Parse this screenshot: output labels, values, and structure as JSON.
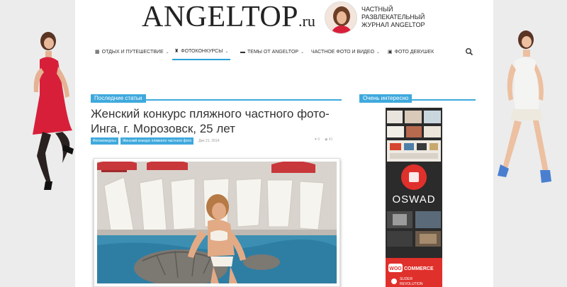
{
  "header": {
    "logo_main": "ANGELTOP",
    "logo_suffix": ".ru",
    "tagline": [
      "ЧАСТНЫЙ",
      "РАЗВЛЕКАТЕЛЬНЫЙ",
      "ЖУРНАЛ ANGELTOP"
    ]
  },
  "nav": {
    "items": [
      {
        "label": "ОТДЫХ И ПУТЕШЕСТВИЕ",
        "icon": "map-icon",
        "has_caret": true,
        "active": false
      },
      {
        "label": "ФОТОКОНКУРСЫ",
        "icon": "trophy-icon",
        "has_caret": true,
        "active": true
      },
      {
        "label": "ТЕМЫ ОТ ANGELTOP",
        "icon": "chat-icon",
        "has_caret": true,
        "active": false
      },
      {
        "label": "ЧАСТНОЕ ФОТО И ВИДЕО",
        "icon": "",
        "has_caret": true,
        "active": false
      },
      {
        "label": "ФОТО ДЕВУШЕК",
        "icon": "image-icon",
        "has_caret": false,
        "active": false
      }
    ],
    "search_icon": "search-icon"
  },
  "main": {
    "section_label": "Последние статьи",
    "post": {
      "title": "Женский конкурс пляжного частного фото- Инга, г. Морозовск, 25 лет",
      "tags": [
        "Фотоконкурсы",
        "Женский конкурс пляжного частного фото"
      ],
      "date": "Дек 21, 2014",
      "likes": "0",
      "views": "41"
    }
  },
  "sidebar": {
    "section_label": "Очень интересно",
    "ad": {
      "brand": "OSWAD",
      "woo": "COMMERCE",
      "woo_prefix": "WOO",
      "slider": "SLIDER",
      "revolution": "REVOLUTION"
    }
  },
  "colors": {
    "accent": "#3fa9dd",
    "ad_red": "#e0302b"
  }
}
